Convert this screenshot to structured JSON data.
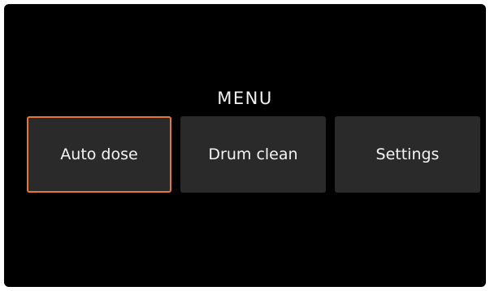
{
  "menu": {
    "title": "MENU",
    "items": [
      {
        "label": "Auto dose",
        "selected": true
      },
      {
        "label": "Drum clean",
        "selected": false
      },
      {
        "label": "Settings",
        "selected": false
      }
    ]
  },
  "colors": {
    "background": "#000000",
    "tile": "#2a2a2a",
    "selection_border": "#e8772e",
    "text": "#f4f4f4"
  }
}
